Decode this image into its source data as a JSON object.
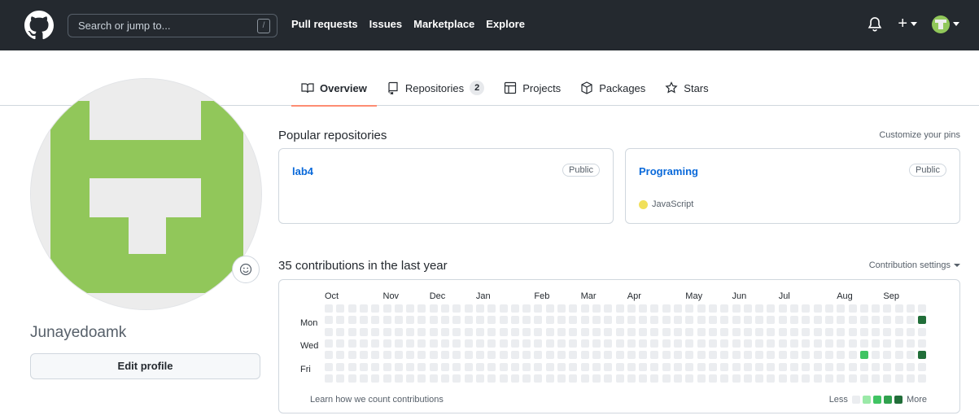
{
  "header": {
    "search_placeholder": "Search or jump to...",
    "search_key": "/",
    "nav": [
      "Pull requests",
      "Issues",
      "Marketplace",
      "Explore"
    ],
    "plus_label": "+"
  },
  "tabs": [
    {
      "label": "Overview",
      "icon": "book-icon",
      "selected": true
    },
    {
      "label": "Repositories",
      "icon": "repo-icon",
      "count": "2"
    },
    {
      "label": "Projects",
      "icon": "table-icon"
    },
    {
      "label": "Packages",
      "icon": "package-icon"
    },
    {
      "label": "Stars",
      "icon": "star-icon"
    }
  ],
  "profile": {
    "username": "Junayedoamk",
    "edit_button": "Edit profile"
  },
  "popular": {
    "title": "Popular repositories",
    "customize": "Customize your pins",
    "repos": [
      {
        "name": "lab4",
        "visibility": "Public",
        "language": ""
      },
      {
        "name": "Programing",
        "visibility": "Public",
        "language": "JavaScript",
        "language_color": "#f1e05a"
      }
    ]
  },
  "contributions": {
    "title": "35 contributions in the last year",
    "settings": "Contribution settings",
    "months": [
      "Oct",
      "Nov",
      "Dec",
      "Jan",
      "Feb",
      "Mar",
      "Apr",
      "May",
      "Jun",
      "Jul",
      "Aug",
      "Sep"
    ],
    "days": [
      "Mon",
      "Wed",
      "Fri"
    ],
    "learn": "Learn how we count contributions",
    "less": "Less",
    "more": "More",
    "level_colors": [
      "#ebedf0",
      "#9be9a8",
      "#40c463",
      "#30a14e",
      "#216e39"
    ],
    "active_cells": [
      {
        "week": 51,
        "day": 1,
        "level": 4
      },
      {
        "week": 46,
        "day": 4,
        "level": 2
      },
      {
        "week": 51,
        "day": 4,
        "level": 4
      }
    ]
  }
}
